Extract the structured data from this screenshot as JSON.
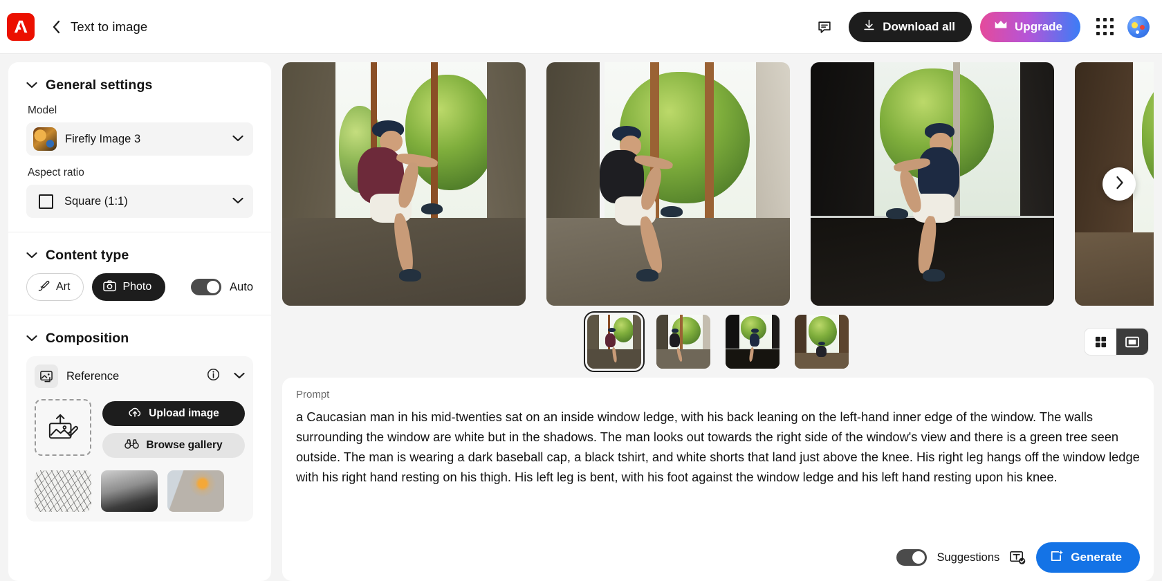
{
  "header": {
    "logo_icon": "adobe-logo-icon",
    "back_icon": "chevron-left-icon",
    "title": "Text to image",
    "feedback_icon": "feedback-chat-icon",
    "download_all_label": "Download all",
    "download_icon": "download-icon",
    "upgrade_label": "Upgrade",
    "crown_icon": "crown-icon",
    "apps_icon": "apps-grid-icon",
    "avatar_icon": "user-avatar"
  },
  "sidebar": {
    "general": {
      "title": "General settings",
      "collapse_icon": "chevron-down-icon",
      "model_label": "Model",
      "model_value": "Firefly Image 3",
      "model_thumb_icon": "model-preview-thumbnail",
      "model_caret_icon": "chevron-down-icon",
      "aspect_label": "Aspect ratio",
      "aspect_value": "Square (1:1)",
      "aspect_icon": "square-ratio-icon",
      "aspect_caret_icon": "chevron-down-icon"
    },
    "content_type": {
      "title": "Content type",
      "collapse_icon": "chevron-down-icon",
      "art_label": "Art",
      "art_icon": "brush-icon",
      "photo_label": "Photo",
      "photo_icon": "camera-icon",
      "auto_label": "Auto",
      "auto_on": true
    },
    "composition": {
      "title": "Composition",
      "collapse_icon": "chevron-down-icon",
      "reference_label": "Reference",
      "reference_icon": "image-reference-icon",
      "info_icon": "info-circle-icon",
      "expand_icon": "chevron-down-icon",
      "dropzone_icon": "upload-image-placeholder-icon",
      "upload_label": "Upload image",
      "upload_icon": "cloud-upload-icon",
      "browse_label": "Browse gallery",
      "browse_icon": "binoculars-icon",
      "presets": [
        "sketch-leaves-preset",
        "grayscale-landscape-preset",
        "interior-lamp-preset"
      ]
    }
  },
  "gallery": {
    "next_icon": "chevron-right-icon",
    "images": [
      {
        "name": "generated-image-1",
        "alt": "man in maroon shirt on window ledge"
      },
      {
        "name": "generated-image-2",
        "alt": "man in black shirt on window ledge"
      },
      {
        "name": "generated-image-3",
        "alt": "man in navy shirt by bright window"
      },
      {
        "name": "generated-image-4",
        "alt": "man seated by open wooden window"
      }
    ],
    "thumbnails": [
      {
        "name": "thumbnail-1",
        "selected": true
      },
      {
        "name": "thumbnail-2",
        "selected": false
      },
      {
        "name": "thumbnail-3",
        "selected": false
      },
      {
        "name": "thumbnail-4",
        "selected": false
      }
    ],
    "view_toggle": {
      "grid_icon": "grid-view-icon",
      "single_icon": "single-view-icon",
      "active": "single"
    }
  },
  "prompt": {
    "label": "Prompt",
    "text": "a Caucasian man in his mid-twenties sat on an inside window ledge, with his back leaning on the left-hand inner edge of the window. The walls surrounding the window are white but in the shadows. The man looks out towards the right side of the window's view and there is a green tree seen outside. The man is wearing a dark baseball cap, a black tshirt, and white shorts that land just above the knee. His right leg hangs off the window ledge with his right hand resting on his thigh. His left leg is bent, with his foot against the window ledge and his left hand resting upon his knee.",
    "suggestions_label": "Suggestions",
    "suggestions_on": true,
    "text_tool_icon": "text-effects-icon",
    "generate_label": "Generate",
    "generate_icon": "generate-sparkle-icon"
  },
  "colors": {
    "accent_blue": "#1473e6",
    "dark": "#1d1d1d",
    "adobe_red": "#eb1000",
    "upgrade_gradient_start": "#e54a9b",
    "upgrade_gradient_end": "#3b7df6"
  }
}
